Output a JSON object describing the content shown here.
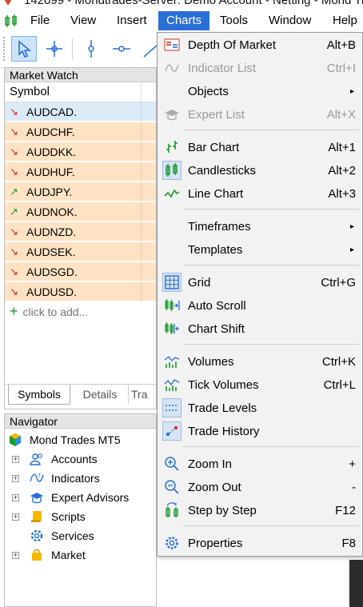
{
  "window": {
    "title": "142099 - Mondtrades-Server: Demo Account - Netting - Mond Tr"
  },
  "menubar": {
    "items": [
      {
        "label": "File"
      },
      {
        "label": "View"
      },
      {
        "label": "Insert"
      },
      {
        "label": "Charts"
      },
      {
        "label": "Tools"
      },
      {
        "label": "Window"
      },
      {
        "label": "Help"
      }
    ]
  },
  "market_watch": {
    "title": "Market Watch",
    "column": "Symbol",
    "rows": [
      {
        "symbol": "AUDCAD.",
        "direction": "down"
      },
      {
        "symbol": "AUDCHF.",
        "direction": "down"
      },
      {
        "symbol": "AUDDKK.",
        "direction": "down"
      },
      {
        "symbol": "AUDHUF.",
        "direction": "down"
      },
      {
        "symbol": "AUDJPY.",
        "direction": "up"
      },
      {
        "symbol": "AUDNOK.",
        "direction": "up"
      },
      {
        "symbol": "AUDNZD.",
        "direction": "down"
      },
      {
        "symbol": "AUDSEK.",
        "direction": "down"
      },
      {
        "symbol": "AUDSGD.",
        "direction": "down"
      },
      {
        "symbol": "AUDUSD.",
        "direction": "down"
      }
    ],
    "add_label": "click to add...",
    "tabs": [
      "Symbols",
      "Details",
      "Tra"
    ]
  },
  "navigator": {
    "title": "Navigator",
    "root": "Mond Trades MT5",
    "items": [
      {
        "label": "Accounts",
        "icon": "accounts-icon"
      },
      {
        "label": "Indicators",
        "icon": "indicators-icon"
      },
      {
        "label": "Expert Advisors",
        "icon": "expert-advisors-icon"
      },
      {
        "label": "Scripts",
        "icon": "scripts-icon"
      },
      {
        "label": "Services",
        "icon": "services-icon"
      },
      {
        "label": "Market",
        "icon": "market-icon"
      }
    ]
  },
  "charts_menu": {
    "items": [
      {
        "label": "Depth Of Market",
        "shortcut": "Alt+B",
        "disabled": false
      },
      {
        "label": "Indicator List",
        "shortcut": "Ctrl+I",
        "disabled": true
      },
      {
        "label": "Objects",
        "submenu": "▸",
        "disabled": false
      },
      {
        "label": "Expert List",
        "shortcut": "Alt+X",
        "disabled": true
      },
      {
        "label": "Bar Chart",
        "shortcut": "Alt+1",
        "disabled": false
      },
      {
        "label": "Candlesticks",
        "shortcut": "Alt+2",
        "disabled": false
      },
      {
        "label": "Line Chart",
        "shortcut": "Alt+3",
        "disabled": false
      },
      {
        "label": "Timeframes",
        "submenu": "▸",
        "disabled": false
      },
      {
        "label": "Templates",
        "submenu": "▸",
        "disabled": false
      },
      {
        "label": "Grid",
        "shortcut": "Ctrl+G",
        "disabled": false
      },
      {
        "label": "Auto Scroll",
        "shortcut": "",
        "disabled": false
      },
      {
        "label": "Chart Shift",
        "shortcut": "",
        "disabled": false
      },
      {
        "label": "Volumes",
        "shortcut": "Ctrl+K",
        "disabled": false
      },
      {
        "label": "Tick Volumes",
        "shortcut": "Ctrl+L",
        "disabled": false
      },
      {
        "label": "Trade Levels",
        "shortcut": "",
        "disabled": false
      },
      {
        "label": "Trade History",
        "shortcut": "",
        "disabled": false
      },
      {
        "label": "Zoom In",
        "shortcut": "+",
        "disabled": false
      },
      {
        "label": "Zoom Out",
        "shortcut": "-",
        "disabled": false
      },
      {
        "label": "Step by Step",
        "shortcut": "F12",
        "disabled": false
      },
      {
        "label": "Properties",
        "shortcut": "F8",
        "disabled": false
      }
    ]
  },
  "colors": {
    "menu_active": "#2a6fd6",
    "row_highlight": "#fde2c4",
    "row_selected": "#dbeaf7",
    "arrow_down": "#d62828",
    "arrow_up": "#1b9a2e"
  }
}
